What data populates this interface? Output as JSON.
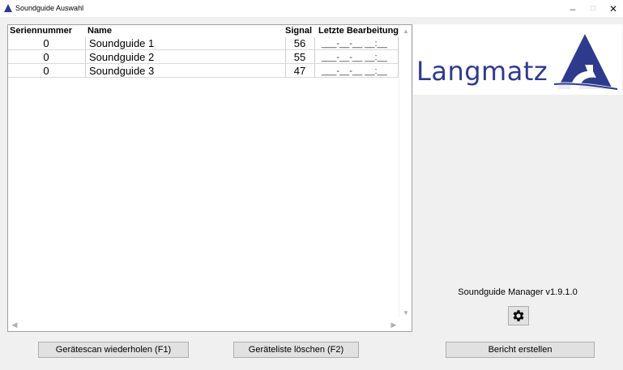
{
  "window": {
    "title": "Soundguide Auswahl",
    "minimize_glyph": "–",
    "maximize_glyph": "□",
    "close_glyph": "✕"
  },
  "device_list": {
    "columns": {
      "serial": "Seriennummer",
      "name": "Name",
      "signal": "Signal",
      "last_edit": "Letzte Bearbeitung"
    },
    "rows": [
      {
        "serial": "0",
        "name": "Soundguide 1",
        "signal": "56",
        "last_edit": "___-__-__ __:__"
      },
      {
        "serial": "0",
        "name": "Soundguide 2",
        "signal": "55",
        "last_edit": "___-__-__ __:__"
      },
      {
        "serial": "0",
        "name": "Soundguide 3",
        "signal": "47",
        "last_edit": "___-__-__ __:__"
      }
    ]
  },
  "logo": {
    "text": "Langmatz",
    "color": "#2e3a8c"
  },
  "version": "Soundguide Manager v1.9.1.0",
  "icons": {
    "settings": "gear-icon",
    "app": "triangle-logo-icon"
  },
  "buttons": {
    "rescan": "Gerätescan wiederholen (F1)",
    "clear": "Geräteliste löschen (F2)",
    "report": "Bericht erstellen"
  }
}
